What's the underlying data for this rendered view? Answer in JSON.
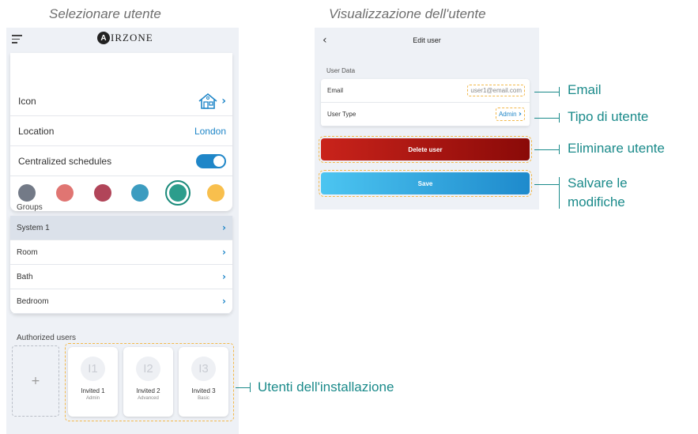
{
  "captions": {
    "left": "Selezionare utente",
    "right": "Visualizzazione dell'utente"
  },
  "left_screen": {
    "logo_mark": "A",
    "logo_text": "IRZONE",
    "settings": {
      "icon_label": "Icon",
      "location_label": "Location",
      "location_value": "London",
      "schedules_label": "Centralized schedules",
      "schedules_enabled": true,
      "colors": [
        "#737a87",
        "#e07572",
        "#b14559",
        "#3c9cc0",
        "#2c9d8c",
        "#f8bf4d"
      ],
      "selected_color_index": 4
    },
    "groups": {
      "label": "Groups",
      "items": [
        {
          "label": "System 1",
          "active": true
        },
        {
          "label": "Room",
          "active": false
        },
        {
          "label": "Bath",
          "active": false
        },
        {
          "label": "Bedroom",
          "active": false
        }
      ]
    },
    "authorized_users": {
      "label": "Authorized users",
      "add_symbol": "+",
      "users": [
        {
          "initials": "I1",
          "name": "Invited 1",
          "role": "Admin"
        },
        {
          "initials": "I2",
          "name": "Invited 2",
          "role": "Advanced"
        },
        {
          "initials": "I3",
          "name": "Invited 3",
          "role": "Basic"
        }
      ]
    }
  },
  "right_screen": {
    "back_symbol": "‹",
    "title": "Edit user",
    "section_label": "User Data",
    "email_label": "Email",
    "email_value": "user1@email.com",
    "user_type_label": "User Type",
    "user_type_value": "Admin",
    "delete_label": "Delete user",
    "save_label": "Save"
  },
  "callouts": {
    "email": "Email",
    "user_type": "Tipo di utente",
    "delete": "Eliminare utente",
    "save_line1": "Salvare le",
    "save_line2": "modifiche",
    "users": "Utenti dell'installazione"
  }
}
